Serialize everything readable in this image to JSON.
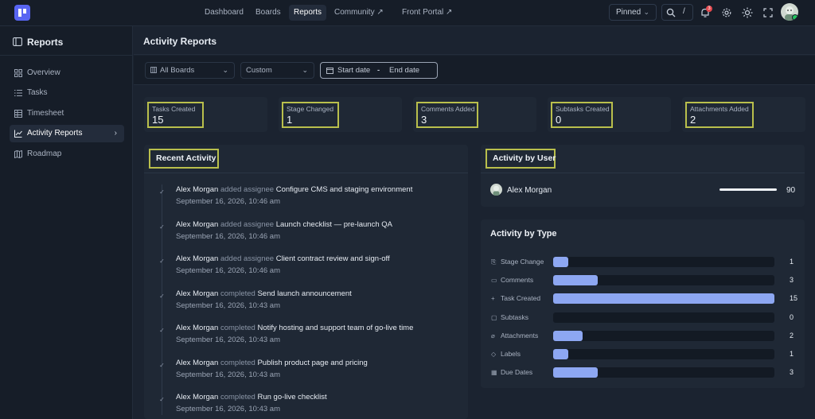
{
  "topnav": {
    "items": [
      "Dashboard",
      "Boards",
      "Reports",
      "Community",
      "Front Portal"
    ],
    "active": "Reports",
    "pinned_label": "Pinned",
    "search_shortcut": "/",
    "notification_count": "3"
  },
  "sidebar": {
    "title": "Reports",
    "items": [
      {
        "label": "Overview",
        "icon": "overview-icon"
      },
      {
        "label": "Tasks",
        "icon": "tasks-icon"
      },
      {
        "label": "Timesheet",
        "icon": "timesheet-icon"
      },
      {
        "label": "Activity Reports",
        "icon": "chart-icon"
      },
      {
        "label": "Roadmap",
        "icon": "map-icon"
      }
    ],
    "active": "Activity Reports"
  },
  "page": {
    "title": "Activity Reports"
  },
  "filters": {
    "board_select": "All Boards",
    "range_select": "Custom",
    "start_placeholder": "Start date",
    "separator": "-",
    "end_placeholder": "End date"
  },
  "stats": [
    {
      "label": "Tasks Created",
      "value": "15"
    },
    {
      "label": "Stage Changed",
      "value": "1"
    },
    {
      "label": "Comments Added",
      "value": "3"
    },
    {
      "label": "Subtasks Created",
      "value": "0"
    },
    {
      "label": "Attachments Added",
      "value": "2"
    }
  ],
  "recent_activity": {
    "title": "Recent Activity",
    "items": [
      {
        "user": "Alex Morgan",
        "action": "added assignee",
        "target": "Configure CMS and staging environment",
        "time": "September 16, 2026, 10:46 am"
      },
      {
        "user": "Alex Morgan",
        "action": "added assignee",
        "target": "Launch checklist — pre-launch QA",
        "time": "September 16, 2026, 10:46 am"
      },
      {
        "user": "Alex Morgan",
        "action": "added assignee",
        "target": "Client contract review and sign-off",
        "time": "September 16, 2026, 10:46 am"
      },
      {
        "user": "Alex Morgan",
        "action": "completed",
        "target": "Send launch announcement",
        "time": "September 16, 2026, 10:43 am"
      },
      {
        "user": "Alex Morgan",
        "action": "completed",
        "target": "Notify hosting and support team of go-live time",
        "time": "September 16, 2026, 10:43 am"
      },
      {
        "user": "Alex Morgan",
        "action": "completed",
        "target": "Publish product page and pricing",
        "time": "September 16, 2026, 10:43 am"
      },
      {
        "user": "Alex Morgan",
        "action": "completed",
        "target": "Run go-live checklist",
        "time": "September 16, 2026, 10:43 am"
      }
    ]
  },
  "activity_by_user": {
    "title": "Activity by User",
    "rows": [
      {
        "name": "Alex Morgan",
        "count": "90",
        "fraction": 1.0
      }
    ]
  },
  "activity_by_type": {
    "title": "Activity by Type",
    "max": 15,
    "rows": [
      {
        "label": "Stage Change",
        "icon": "stage-icon",
        "value": 1
      },
      {
        "label": "Comments",
        "icon": "comment-icon",
        "value": 3
      },
      {
        "label": "Task Created",
        "icon": "plus-icon",
        "value": 15
      },
      {
        "label": "Subtasks",
        "icon": "subtask-icon",
        "value": 0
      },
      {
        "label": "Attachments",
        "icon": "paperclip-icon",
        "value": 2
      },
      {
        "label": "Labels",
        "icon": "tag-icon",
        "value": 1
      },
      {
        "label": "Due Dates",
        "icon": "calendar-icon",
        "value": 3
      }
    ]
  },
  "colors": {
    "accent": "#5865f2",
    "bar_fill": "#8da7f2",
    "highlight_border": "#b9bf4c",
    "notification": "#e5484d"
  }
}
